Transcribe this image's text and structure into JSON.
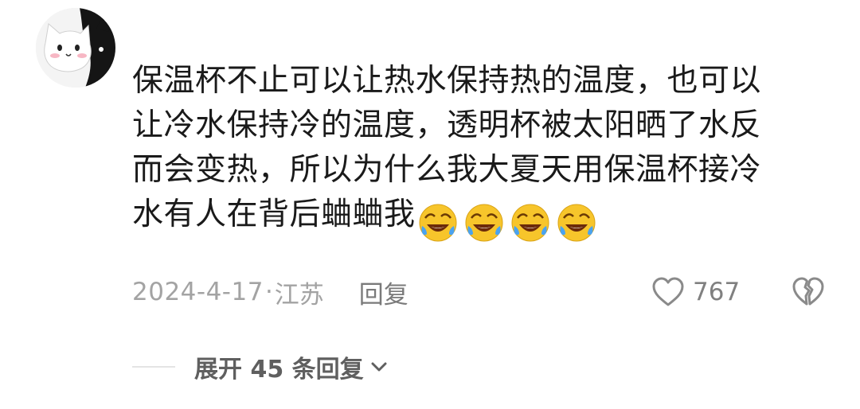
{
  "comment": {
    "text_lines": [
      "保温杯不止可以让热水保持热的温度，也可以",
      "让冷水保持冷的温度，透明杯被太阳晒了水反",
      "而会变热，所以为什么我大夏天用保温杯接冷",
      "水有人在背后蛐蛐我"
    ],
    "emojis": [
      "rolling-laughing-emoji",
      "rolling-laughing-emoji",
      "rolling-laughing-emoji",
      "rolling-laughing-emoji"
    ],
    "date": "2024-4-17",
    "separator": "·",
    "location": "江苏",
    "reply_label": "回复",
    "like_count": "767",
    "expand_label": "展开 45 条回复"
  },
  "icons": {
    "avatar": "cat-avatar",
    "like": "heart-outline-icon",
    "dislike": "broken-heart-icon",
    "expand": "chevron-down-icon"
  },
  "colors": {
    "text": "#1a1a1a",
    "meta": "#a3a3a3",
    "emoji_yellow": "#f7c52b"
  }
}
